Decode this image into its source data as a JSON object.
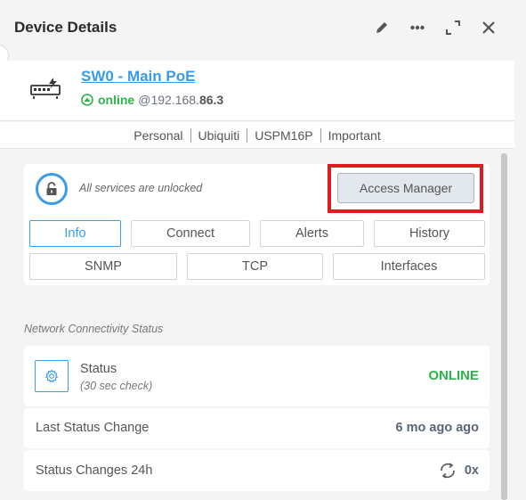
{
  "panel": {
    "title": "Device Details",
    "actions": [
      "edit-icon",
      "more-icon",
      "expand-icon",
      "close-icon"
    ]
  },
  "device": {
    "name": "SW0 - Main PoE",
    "status": "online",
    "ip_prefix": "@192.168.",
    "ip_suffix": "86.3",
    "tags": [
      "Personal",
      "Ubiquiti",
      "USPM16P",
      "Important"
    ]
  },
  "services": {
    "lock_text": "All services are unlocked",
    "access_manager_label": "Access Manager"
  },
  "tabs": {
    "row1": [
      "Info",
      "Connect",
      "Alerts",
      "History"
    ],
    "row2": [
      "SNMP",
      "TCP",
      "Interfaces"
    ],
    "active": "Info"
  },
  "connectivity": {
    "section_title": "Network Connectivity Status",
    "status_label": "Status",
    "status_sub": "(30 sec check)",
    "status_value": "ONLINE",
    "last_change_label": "Last Status Change",
    "last_change_value": "6 mo ago ago",
    "changes_label": "Status Changes 24h",
    "changes_value": "0x"
  },
  "colors": {
    "accent": "#3a9bea",
    "online": "#2db34a",
    "highlight": "#e01b1b"
  }
}
